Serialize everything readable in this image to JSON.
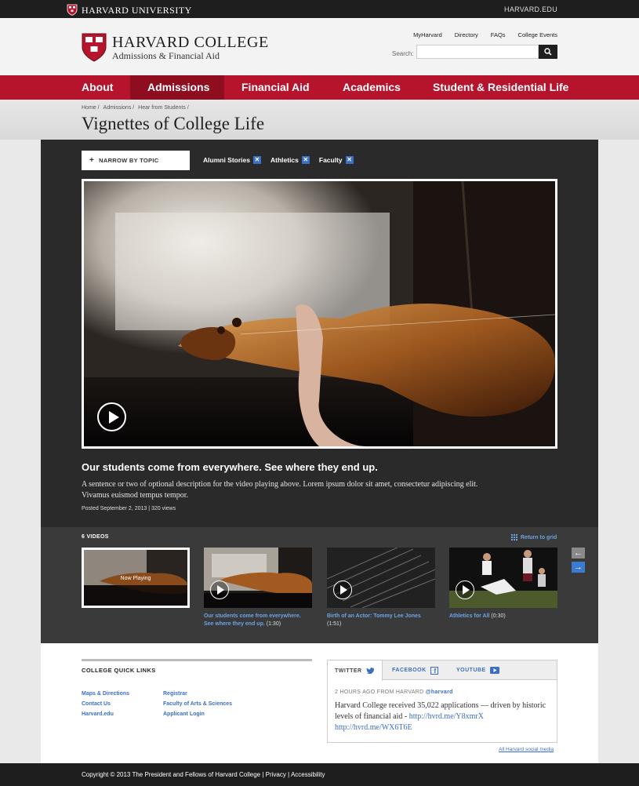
{
  "university_bar": {
    "name": "HARVARD UNIVERSITY",
    "link": "HARVARD.EDU"
  },
  "header": {
    "title": "HARVARD COLLEGE",
    "subtitle": "Admissions & Financial Aid",
    "util_links": [
      "MyHarvard",
      "Directory",
      "FAQs",
      "College Events"
    ],
    "search_label": "Search:",
    "search_value": ""
  },
  "nav": {
    "items": [
      "About",
      "Admissions",
      "Financial Aid",
      "Academics",
      "Student & Residential Life"
    ],
    "active": "Admissions"
  },
  "breadcrumb": [
    "Home",
    "Admissions",
    "Hear from Students"
  ],
  "page_title": "Vignettes of College Life",
  "filters": {
    "narrow_label": "NARROW BY TOPIC",
    "tags": [
      "Alumni Stories",
      "Athletics",
      "Faculty"
    ]
  },
  "video": {
    "title": "Our students come from everywhere. See where they end up.",
    "description": "A sentence or two of optional description for the video playing above. Lorem ipsum dolor sit amet, consectetur adipiscing elit. Vivamus euismod tempus tempor.",
    "meta": "Posted September 2, 2013  |  320 views"
  },
  "strip": {
    "count_label": "6 VIDEOS",
    "return_label": "Return to grid",
    "now_playing": "Now Playing",
    "thumbs": [
      {
        "title_1": "Our students come from everywhere.",
        "title_2": "See where they end up.",
        "duration": "(1:30)"
      },
      {
        "title_1": "Birth of an Actor: Tommy Lee Jones",
        "title_2": "",
        "duration": "(1:51)"
      },
      {
        "title_1": "Athletics for All",
        "title_2": "",
        "duration": "(0:30)"
      }
    ]
  },
  "quick_links": {
    "heading": "COLLEGE QUICK LINKS",
    "col1": [
      "Maps & Directions",
      "Contact Us",
      "Harvard.edu"
    ],
    "col2": [
      "Registrar",
      "Faculty of Arts & Sciences",
      "Applicant Login"
    ]
  },
  "social": {
    "tabs": [
      "TWITTER",
      "FACEBOOK",
      "YOUTUBE"
    ],
    "meta": "2 HOURS AGO FROM HARVARD",
    "handle": "@harvard",
    "tweet": "Harvard College received 35,022 applications — driven by historic levels of financial aid -",
    "link1": "http://hvrd.me/Y8xmrX",
    "link2": "http://hvrd.me/WX6T6E",
    "all_link": "All Harvard social media"
  },
  "footer": {
    "copyright": "Copyright © 2013 The President and Fellows of Harvard College",
    "links": [
      "Privacy",
      "Accessibility"
    ]
  },
  "colors": {
    "crimson": "#b6142c",
    "crimson_dark": "#8e0e20",
    "link_blue": "#3b6fc4",
    "dark_bg": "#2a2a2a"
  }
}
